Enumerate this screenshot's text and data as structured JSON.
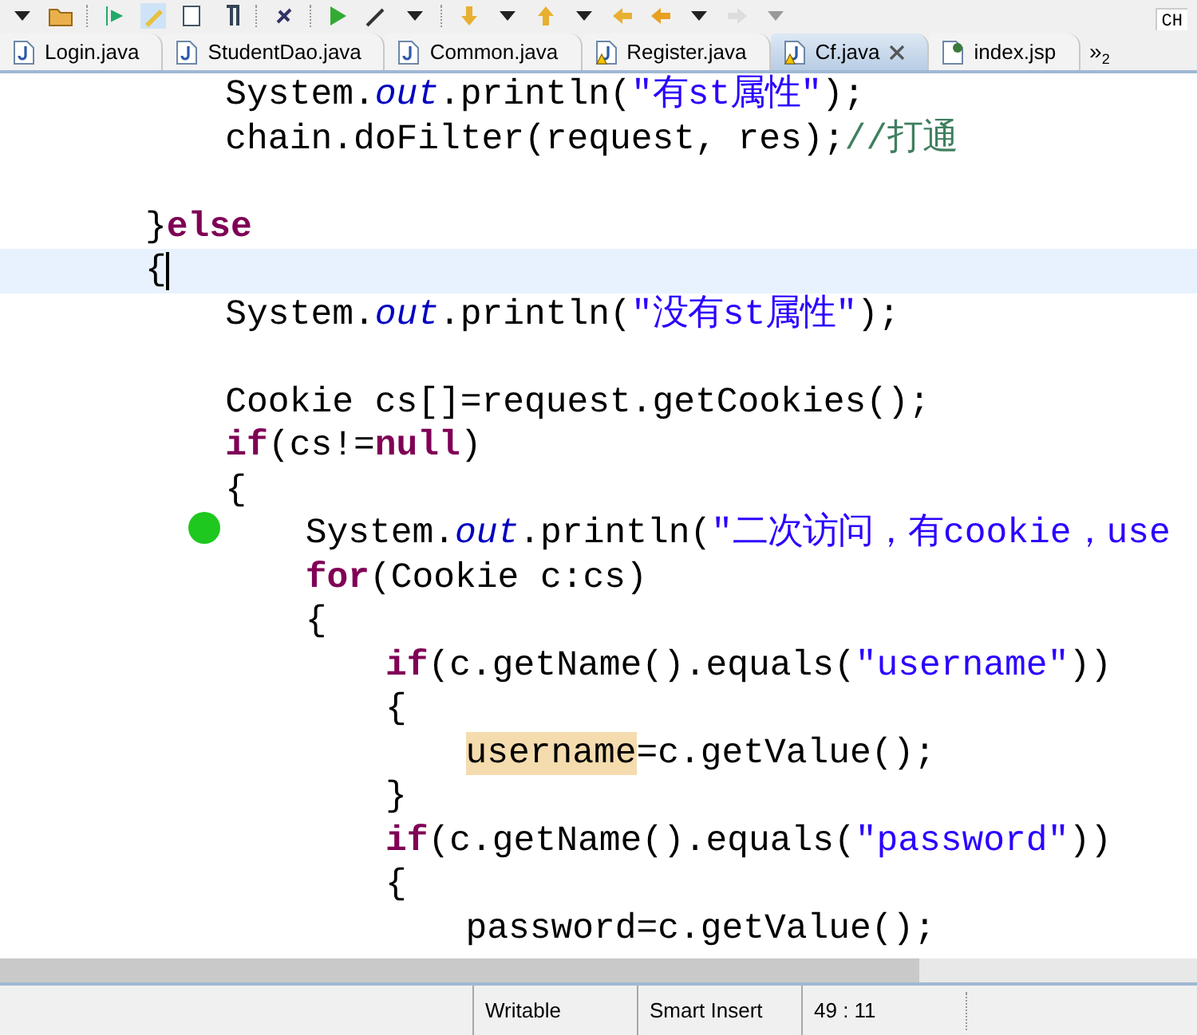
{
  "toolbar": {
    "language_indicator": "CH"
  },
  "tabs": [
    {
      "label": "Login.java",
      "warning": false,
      "selected": false,
      "closable": false,
      "kind": "java"
    },
    {
      "label": "StudentDao.java",
      "warning": false,
      "selected": false,
      "closable": false,
      "kind": "java"
    },
    {
      "label": "Common.java",
      "warning": false,
      "selected": false,
      "closable": false,
      "kind": "java"
    },
    {
      "label": "Register.java",
      "warning": true,
      "selected": false,
      "closable": false,
      "kind": "java"
    },
    {
      "label": "Cf.java",
      "warning": true,
      "selected": true,
      "closable": true,
      "kind": "java"
    },
    {
      "label": "index.jsp",
      "warning": false,
      "selected": false,
      "closable": false,
      "kind": "jsp"
    }
  ],
  "tab_overflow": {
    "glyph": "»",
    "count": "2"
  },
  "editor": {
    "lines": [
      {
        "children": [
          {
            "current": false,
            "tokens": [
              {
                "kind": "plain",
                "text": "System."
              },
              {
                "kind": "static",
                "text": "out"
              },
              {
                "kind": "plain",
                "text": ".println("
              },
              {
                "kind": "string",
                "text": "\"有st属性\""
              },
              {
                "kind": "plain",
                "text": ");"
              }
            ]
          },
          {
            "current": false,
            "tokens": [
              {
                "kind": "plain",
                "text": "chain.doFilter(request, res);"
              },
              {
                "kind": "comment",
                "text": "//打通"
              }
            ]
          }
        ]
      },
      {
        "current": false
      },
      {
        "current": false,
        "tokens": [
          {
            "kind": "plain",
            "text": "}"
          },
          {
            "kind": "keyword",
            "text": "else"
          }
        ]
      },
      {
        "current": true,
        "tokens": [
          {
            "kind": "plain",
            "text": "{"
          }
        ],
        "children": [
          {
            "current": false,
            "tokens": [
              {
                "kind": "plain",
                "text": "System."
              },
              {
                "kind": "static",
                "text": "out"
              },
              {
                "kind": "plain",
                "text": ".println("
              },
              {
                "kind": "string",
                "text": "\"没有st属性\""
              },
              {
                "kind": "plain",
                "text": ");"
              }
            ]
          },
          {
            "current": false
          },
          {
            "current": false,
            "tokens": [
              {
                "kind": "plain",
                "text": "Cookie cs[]=request.getCookies();"
              }
            ]
          },
          {
            "current": false,
            "tokens": [
              {
                "kind": "keyword",
                "text": "if"
              },
              {
                "kind": "plain",
                "text": "(cs!="
              },
              {
                "kind": "keyword",
                "text": "null"
              },
              {
                "kind": "plain",
                "text": ")"
              }
            ]
          },
          {
            "current": false,
            "tokens": [
              {
                "kind": "plain",
                "text": "{"
              }
            ],
            "children": [
              {
                "current": false,
                "tokens": [
                  {
                    "kind": "plain",
                    "text": "System."
                  },
                  {
                    "kind": "static",
                    "text": "out"
                  },
                  {
                    "kind": "plain",
                    "text": ".println("
                  },
                  {
                    "kind": "string",
                    "text": "\"二次访问，有cookie，use"
                  }
                ]
              },
              {
                "current": false,
                "tokens": [
                  {
                    "kind": "keyword",
                    "text": "for"
                  },
                  {
                    "kind": "plain",
                    "text": "(Cookie c:cs)"
                  }
                ]
              },
              {
                "current": false,
                "tokens": [
                  {
                    "kind": "plain",
                    "text": "{"
                  }
                ],
                "children": [
                  {
                    "current": false,
                    "tokens": [
                      {
                        "kind": "keyword",
                        "text": "if"
                      },
                      {
                        "kind": "plain",
                        "text": "(c.getName().equals("
                      },
                      {
                        "kind": "string",
                        "text": "\"username\""
                      },
                      {
                        "kind": "plain",
                        "text": "))"
                      }
                    ]
                  },
                  {
                    "current": false,
                    "tokens": [
                      {
                        "kind": "plain",
                        "text": "{"
                      }
                    ],
                    "children": [
                      {
                        "current": false,
                        "tokens": [
                          {
                            "kind": "occurrence",
                            "text": "username"
                          },
                          {
                            "kind": "plain",
                            "text": "=c.getValue();"
                          }
                        ]
                      }
                    ]
                  },
                  {
                    "current": false,
                    "tokens": [
                      {
                        "kind": "plain",
                        "text": "}"
                      }
                    ]
                  },
                  {
                    "current": false,
                    "tokens": [
                      {
                        "kind": "keyword",
                        "text": "if"
                      },
                      {
                        "kind": "plain",
                        "text": "(c.getName().equals("
                      },
                      {
                        "kind": "string",
                        "text": "\"password\""
                      },
                      {
                        "kind": "plain",
                        "text": "))"
                      }
                    ]
                  },
                  {
                    "current": false,
                    "tokens": [
                      {
                        "kind": "plain",
                        "text": "{"
                      }
                    ],
                    "children": [
                      {
                        "current": false,
                        "tokens": [
                          {
                            "kind": "plain",
                            "text": "password=c.getValue();"
                          }
                        ]
                      }
                    ]
                  }
                ]
              }
            ]
          }
        ]
      }
    ]
  },
  "status_bar": [
    "Writable",
    "Smart Insert",
    "49 : 11"
  ]
}
